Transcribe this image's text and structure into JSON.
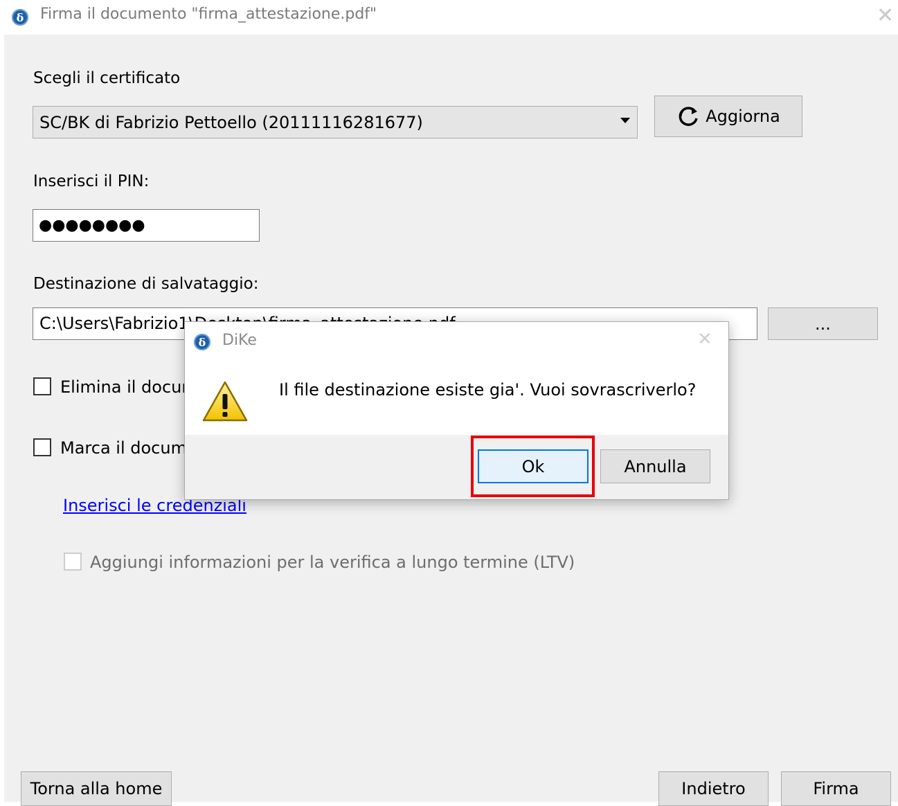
{
  "window": {
    "title": "Firma il documento \"firma_attestazione.pdf\"",
    "app_icon": "dike-logo-icon",
    "close_icon": "close-icon"
  },
  "certificate": {
    "label": "Scegli il certificato",
    "selected": "SC/BK di Fabrizio Pettoello (20111116281677)",
    "refresh_label": "Aggiorna",
    "refresh_icon": "refresh-icon"
  },
  "pin": {
    "label": "Inserisci il PIN:",
    "masked_value": "●●●●●●●●"
  },
  "destination": {
    "label": "Destinazione di salvataggio:",
    "path": "C:\\Users\\Fabrizio1\\Desktop\\firma_attestazione.pdf",
    "browse_label": "..."
  },
  "options": {
    "delete_original": "Elimina il documento originale",
    "timestamp": "Marca il documento",
    "credentials_link": "Inserisci le credenziali",
    "ltv": "Aggiungi informazioni per la verifica a lungo termine (LTV)"
  },
  "footer": {
    "home": "Torna alla home",
    "back": "Indietro",
    "sign": "Firma"
  },
  "dialog": {
    "title": "DiKe",
    "message": "Il file destinazione esiste gia'. Vuoi sovrascriverlo?",
    "ok": "Ok",
    "cancel": "Annulla",
    "icon": "warning-icon"
  },
  "colors": {
    "highlight": "#e8000b",
    "link": "#0000ff",
    "focus": "#0078d7"
  }
}
